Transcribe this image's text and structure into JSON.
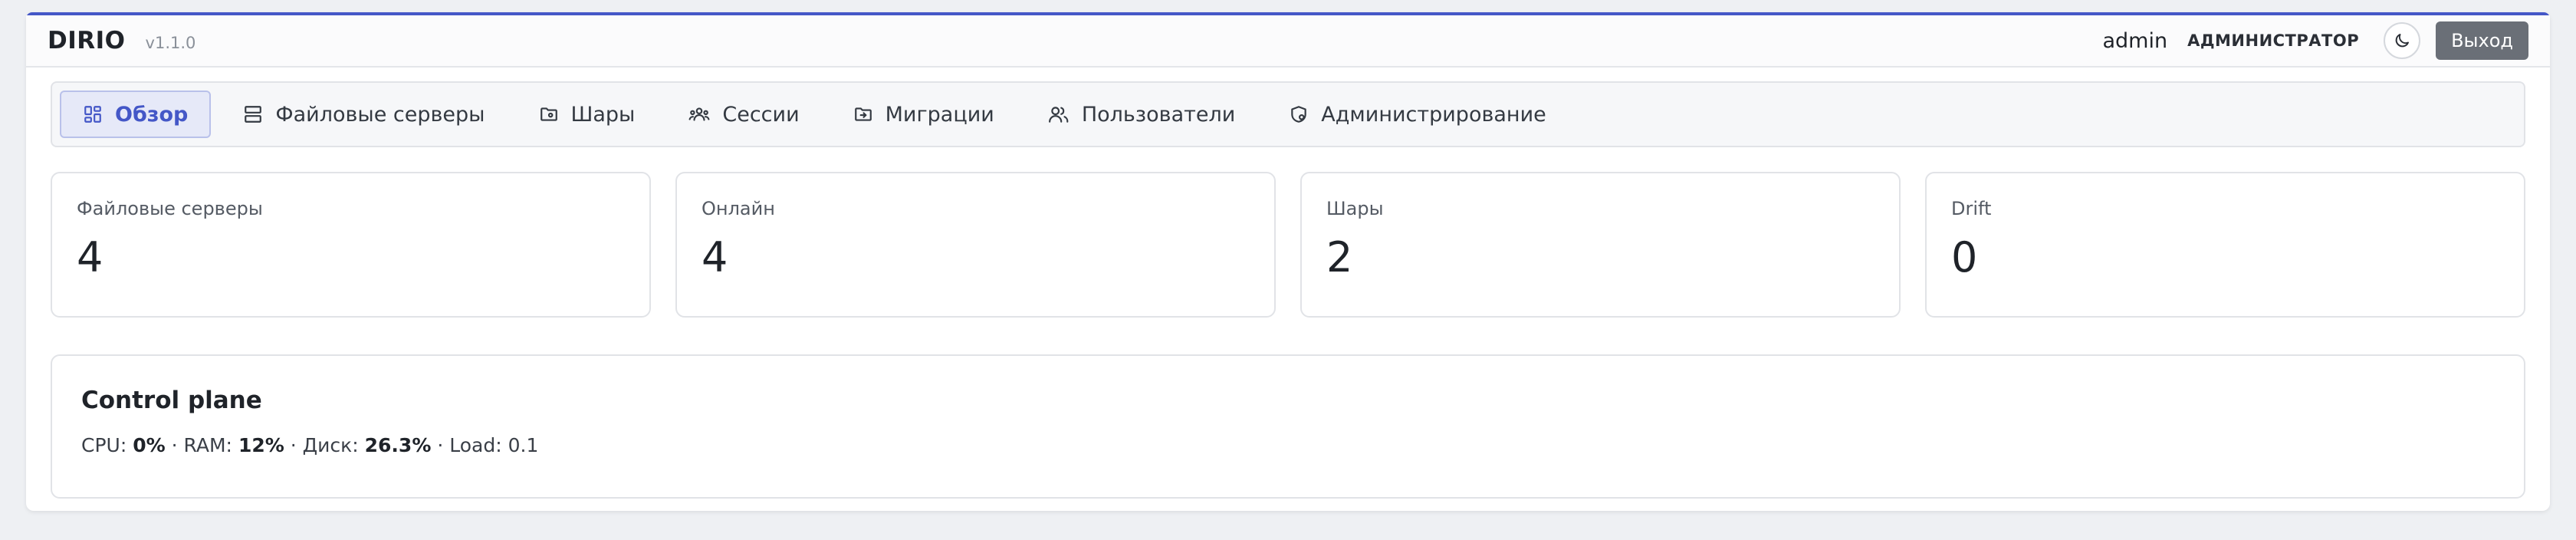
{
  "header": {
    "brand": "DIRIO",
    "version": "v1.1.0",
    "user": "admin",
    "role": "АДМИНИСТРАТОР",
    "theme_icon": "moon-icon",
    "logout_label": "Выход"
  },
  "tabs": [
    {
      "label": "Обзор",
      "icon": "dashboard-icon",
      "active": true
    },
    {
      "label": "Файловые серверы",
      "icon": "server-icon",
      "active": false
    },
    {
      "label": "Шары",
      "icon": "folder-icon",
      "active": false
    },
    {
      "label": "Сессии",
      "icon": "users-group-icon",
      "active": false
    },
    {
      "label": "Миграции",
      "icon": "folder-move-icon",
      "active": false
    },
    {
      "label": "Пользователи",
      "icon": "users-icon",
      "active": false
    },
    {
      "label": "Администрирование",
      "icon": "shield-gear-icon",
      "active": false
    }
  ],
  "stats_cards": [
    {
      "label": "Файловые серверы",
      "value": "4"
    },
    {
      "label": "Онлайн",
      "value": "4"
    },
    {
      "label": "Шары",
      "value": "2"
    },
    {
      "label": "Drift",
      "value": "0"
    }
  ],
  "control_plane": {
    "title": "Control plane",
    "cpu_label": "CPU:",
    "cpu_value": "0%",
    "sep1": "·",
    "ram_label": "RAM:",
    "ram_value": "12%",
    "sep2": "·",
    "disk_label": "Диск:",
    "disk_value": "26.3%",
    "sep3": "·",
    "load_label": "Load:",
    "load_value": "0.1"
  },
  "colors": {
    "accent": "#4457c7",
    "logout_bg": "#6a6f77"
  }
}
